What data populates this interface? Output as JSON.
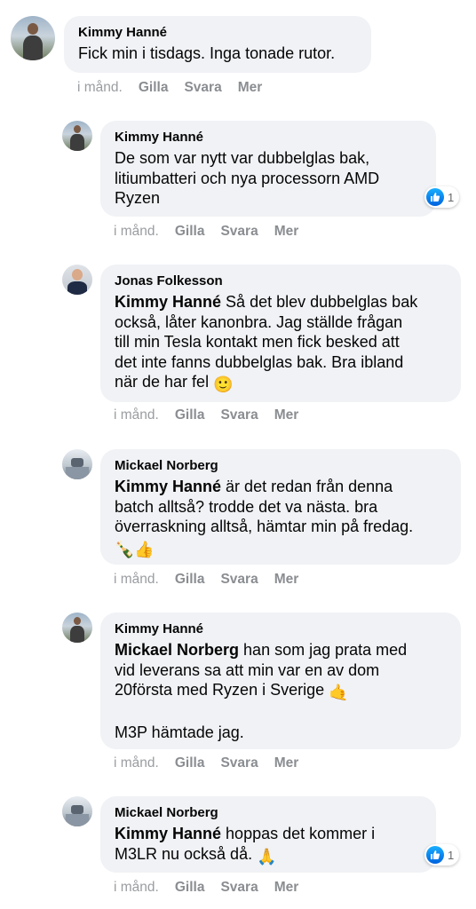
{
  "actions": {
    "time": "i månd.",
    "like": "Gilla",
    "reply": "Svara",
    "more": "Mer"
  },
  "comments": [
    {
      "author": "Kimmy Hanné",
      "text": "Fick min i tisdags. Inga tonade rutor."
    },
    {
      "author": "Kimmy Hanné",
      "text": "De som var nytt var dubbelglas bak,\nlitiumbatteri och nya processorn AMD\nRyzen",
      "reaction_count": "1"
    },
    {
      "author": "Jonas Folkesson",
      "mention": "Kimmy Hanné",
      "text": " Så det blev dubbelglas bak\nockså, låter kanonbra. Jag ställde frågan\ntill min Tesla kontakt men fick besked att\ndet inte fanns dubbelglas bak. Bra ibland\nnär de har fel ",
      "emoji": "🙂"
    },
    {
      "author": "Mickael Norberg",
      "mention": "Kimmy Hanné",
      "text": " är det redan från denna\nbatch alltså? trodde det va nästa. bra\növerraskning alltså, hämtar min på fredag.\n",
      "emoji": "🍾👍"
    },
    {
      "author": "Kimmy Hanné",
      "mention": "Mickael Norberg",
      "text": " han som jag prata med\nvid leverans sa att min var en av dom\n20första med Ryzen i Sverige ",
      "emoji": "🤙",
      "text2": "M3P hämtade jag."
    },
    {
      "author": "Mickael Norberg",
      "mention": "Kimmy Hanné",
      "text": " hoppas det kommer i\nM3LR nu också då. ",
      "emoji": "🙏",
      "reaction_count": "1"
    }
  ]
}
